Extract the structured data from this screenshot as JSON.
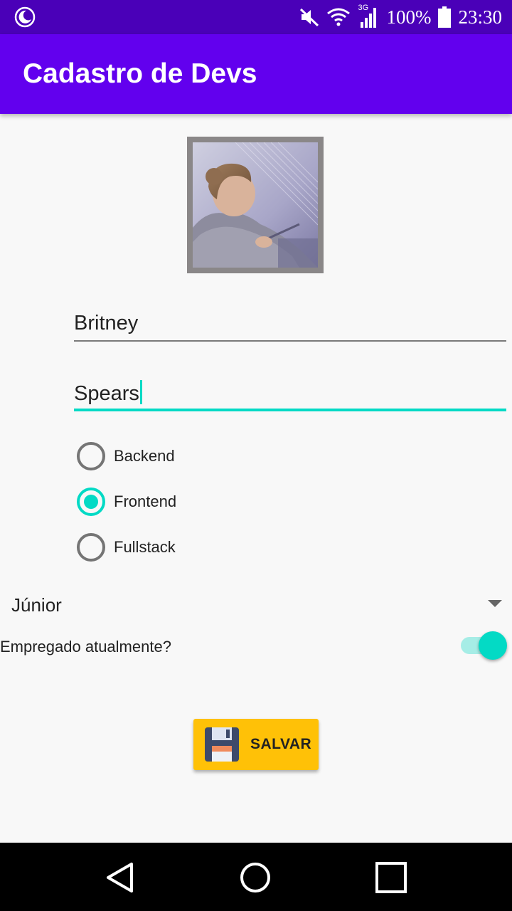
{
  "status_bar": {
    "icons": [
      "night-mode-icon",
      "mute-icon",
      "wifi-icon",
      "signal-3g-icon",
      "battery-icon"
    ],
    "network_label": "3G",
    "battery": "100%",
    "time": "23:30"
  },
  "app_bar": {
    "title": "Cadastro de Devs",
    "color": "#6200ee"
  },
  "form": {
    "photo_alt": "Foto do dev",
    "first_name": {
      "value": "Britney"
    },
    "last_name": {
      "value": "Spears",
      "focused": true
    },
    "role_options": [
      {
        "label": "Backend",
        "checked": false
      },
      {
        "label": "Frontend",
        "checked": true
      },
      {
        "label": "Fullstack",
        "checked": false
      }
    ],
    "level": {
      "value": "Júnior"
    },
    "employed": {
      "label": "Empregado atualmente?",
      "checked": true
    },
    "save_button": {
      "label": "SALVAR",
      "icon": "floppy-disk-icon"
    }
  },
  "colors": {
    "accent": "#03dac5",
    "primary": "#6200ee",
    "primary_dark": "#4a00b8",
    "button": "#ffc107"
  },
  "nav_bar": {
    "icons": [
      "back-icon",
      "home-icon",
      "recent-apps-icon"
    ]
  }
}
